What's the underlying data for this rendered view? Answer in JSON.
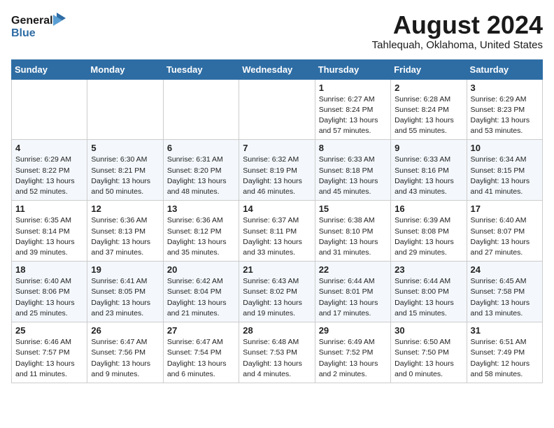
{
  "header": {
    "logo_line1": "General",
    "logo_line2": "Blue",
    "main_title": "August 2024",
    "subtitle": "Tahlequah, Oklahoma, United States"
  },
  "weekdays": [
    "Sunday",
    "Monday",
    "Tuesday",
    "Wednesday",
    "Thursday",
    "Friday",
    "Saturday"
  ],
  "weeks": [
    [
      {
        "day": "",
        "info": ""
      },
      {
        "day": "",
        "info": ""
      },
      {
        "day": "",
        "info": ""
      },
      {
        "day": "",
        "info": ""
      },
      {
        "day": "1",
        "info": "Sunrise: 6:27 AM\nSunset: 8:24 PM\nDaylight: 13 hours\nand 57 minutes."
      },
      {
        "day": "2",
        "info": "Sunrise: 6:28 AM\nSunset: 8:24 PM\nDaylight: 13 hours\nand 55 minutes."
      },
      {
        "day": "3",
        "info": "Sunrise: 6:29 AM\nSunset: 8:23 PM\nDaylight: 13 hours\nand 53 minutes."
      }
    ],
    [
      {
        "day": "4",
        "info": "Sunrise: 6:29 AM\nSunset: 8:22 PM\nDaylight: 13 hours\nand 52 minutes."
      },
      {
        "day": "5",
        "info": "Sunrise: 6:30 AM\nSunset: 8:21 PM\nDaylight: 13 hours\nand 50 minutes."
      },
      {
        "day": "6",
        "info": "Sunrise: 6:31 AM\nSunset: 8:20 PM\nDaylight: 13 hours\nand 48 minutes."
      },
      {
        "day": "7",
        "info": "Sunrise: 6:32 AM\nSunset: 8:19 PM\nDaylight: 13 hours\nand 46 minutes."
      },
      {
        "day": "8",
        "info": "Sunrise: 6:33 AM\nSunset: 8:18 PM\nDaylight: 13 hours\nand 45 minutes."
      },
      {
        "day": "9",
        "info": "Sunrise: 6:33 AM\nSunset: 8:16 PM\nDaylight: 13 hours\nand 43 minutes."
      },
      {
        "day": "10",
        "info": "Sunrise: 6:34 AM\nSunset: 8:15 PM\nDaylight: 13 hours\nand 41 minutes."
      }
    ],
    [
      {
        "day": "11",
        "info": "Sunrise: 6:35 AM\nSunset: 8:14 PM\nDaylight: 13 hours\nand 39 minutes."
      },
      {
        "day": "12",
        "info": "Sunrise: 6:36 AM\nSunset: 8:13 PM\nDaylight: 13 hours\nand 37 minutes."
      },
      {
        "day": "13",
        "info": "Sunrise: 6:36 AM\nSunset: 8:12 PM\nDaylight: 13 hours\nand 35 minutes."
      },
      {
        "day": "14",
        "info": "Sunrise: 6:37 AM\nSunset: 8:11 PM\nDaylight: 13 hours\nand 33 minutes."
      },
      {
        "day": "15",
        "info": "Sunrise: 6:38 AM\nSunset: 8:10 PM\nDaylight: 13 hours\nand 31 minutes."
      },
      {
        "day": "16",
        "info": "Sunrise: 6:39 AM\nSunset: 8:08 PM\nDaylight: 13 hours\nand 29 minutes."
      },
      {
        "day": "17",
        "info": "Sunrise: 6:40 AM\nSunset: 8:07 PM\nDaylight: 13 hours\nand 27 minutes."
      }
    ],
    [
      {
        "day": "18",
        "info": "Sunrise: 6:40 AM\nSunset: 8:06 PM\nDaylight: 13 hours\nand 25 minutes."
      },
      {
        "day": "19",
        "info": "Sunrise: 6:41 AM\nSunset: 8:05 PM\nDaylight: 13 hours\nand 23 minutes."
      },
      {
        "day": "20",
        "info": "Sunrise: 6:42 AM\nSunset: 8:04 PM\nDaylight: 13 hours\nand 21 minutes."
      },
      {
        "day": "21",
        "info": "Sunrise: 6:43 AM\nSunset: 8:02 PM\nDaylight: 13 hours\nand 19 minutes."
      },
      {
        "day": "22",
        "info": "Sunrise: 6:44 AM\nSunset: 8:01 PM\nDaylight: 13 hours\nand 17 minutes."
      },
      {
        "day": "23",
        "info": "Sunrise: 6:44 AM\nSunset: 8:00 PM\nDaylight: 13 hours\nand 15 minutes."
      },
      {
        "day": "24",
        "info": "Sunrise: 6:45 AM\nSunset: 7:58 PM\nDaylight: 13 hours\nand 13 minutes."
      }
    ],
    [
      {
        "day": "25",
        "info": "Sunrise: 6:46 AM\nSunset: 7:57 PM\nDaylight: 13 hours\nand 11 minutes."
      },
      {
        "day": "26",
        "info": "Sunrise: 6:47 AM\nSunset: 7:56 PM\nDaylight: 13 hours\nand 9 minutes."
      },
      {
        "day": "27",
        "info": "Sunrise: 6:47 AM\nSunset: 7:54 PM\nDaylight: 13 hours\nand 6 minutes."
      },
      {
        "day": "28",
        "info": "Sunrise: 6:48 AM\nSunset: 7:53 PM\nDaylight: 13 hours\nand 4 minutes."
      },
      {
        "day": "29",
        "info": "Sunrise: 6:49 AM\nSunset: 7:52 PM\nDaylight: 13 hours\nand 2 minutes."
      },
      {
        "day": "30",
        "info": "Sunrise: 6:50 AM\nSunset: 7:50 PM\nDaylight: 13 hours\nand 0 minutes."
      },
      {
        "day": "31",
        "info": "Sunrise: 6:51 AM\nSunset: 7:49 PM\nDaylight: 12 hours\nand 58 minutes."
      }
    ]
  ]
}
